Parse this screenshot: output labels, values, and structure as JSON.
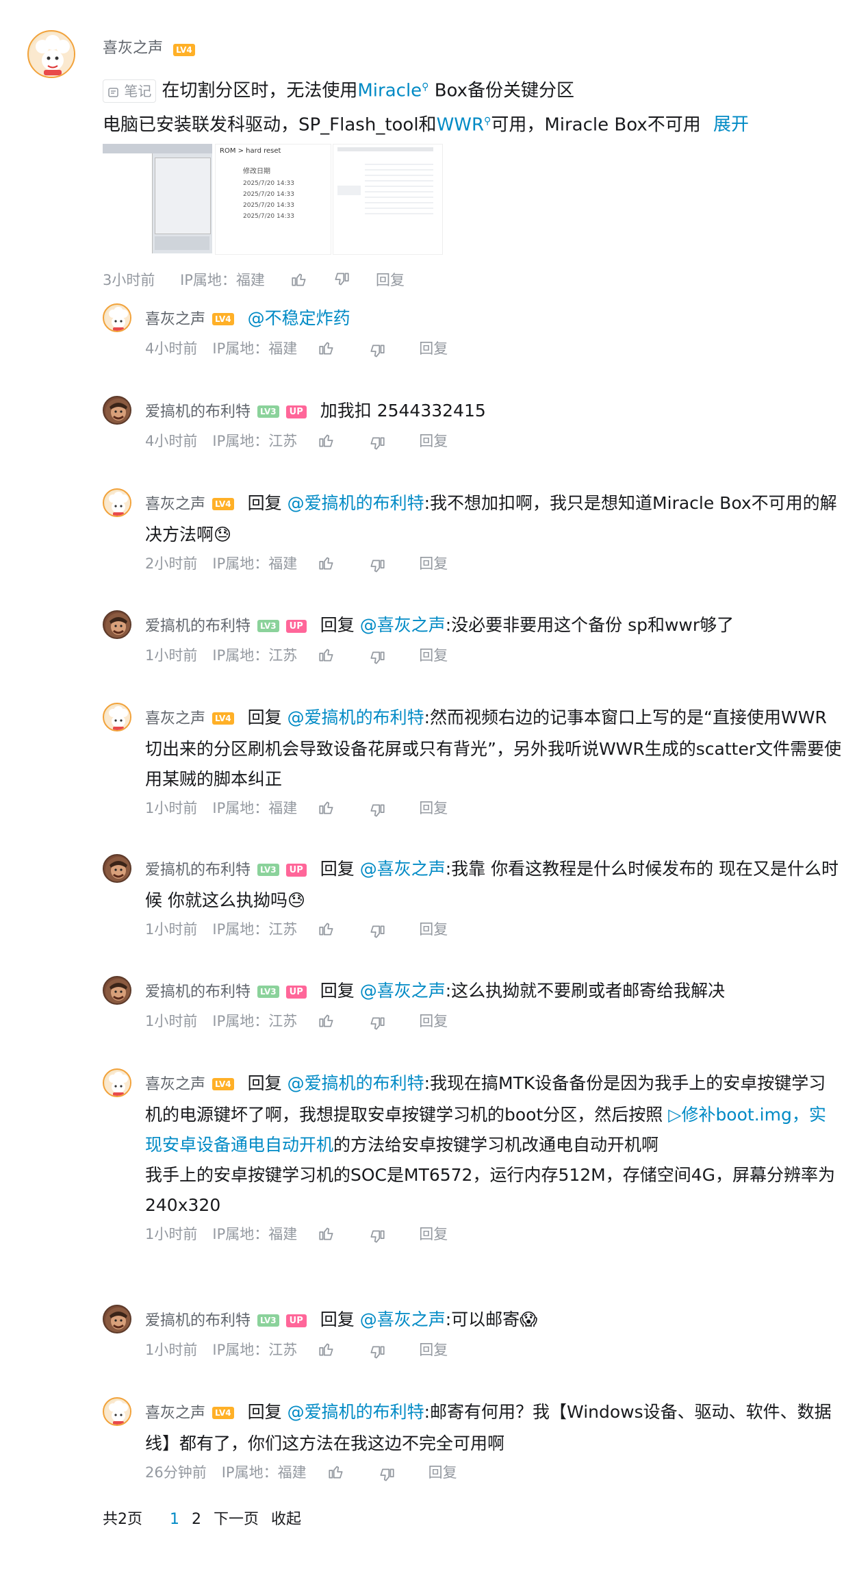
{
  "root": {
    "username": "喜灰之声",
    "level": "LV4",
    "note_label": "笔记",
    "line1_a": "在切割分区时，无法使用",
    "line1_link": "Miracle",
    "line1_b": " Box备份关键分区",
    "line2_a": "电脑已安装联发科驱动，SP_Flash_tool和",
    "line2_link": "WWR",
    "line2_b": "可用，Miracle Box不可用",
    "expand": "展开",
    "image2_path": "ROM  >  hard reset",
    "image2_col": "修改日期",
    "image2_dates": [
      "2025/7/20 14:33",
      "2025/7/20 14:33",
      "2025/7/20 14:33",
      "2025/7/20 14:33"
    ],
    "time": "3小时前",
    "ip": "IP属地：福建",
    "reply_label": "回复"
  },
  "replies": [
    {
      "user": "喜灰之声",
      "level": "LV4",
      "up": false,
      "prefix": "",
      "mention": "@不稳定炸药",
      "text": "",
      "time": "4小时前",
      "ip": "IP属地：福建"
    },
    {
      "user": "爱搞机的布利特",
      "level": "LV3",
      "up": true,
      "prefix": "",
      "mention": "",
      "text": "加我扣 2544332415",
      "time": "4小时前",
      "ip": "IP属地：江苏"
    },
    {
      "user": "喜灰之声",
      "level": "LV4",
      "up": false,
      "prefix": "回复",
      "mention": "@爱搞机的布利特",
      "text": ":我不想加扣啊，我只是想知道Miracle Box不可用的解决方法啊😓",
      "time": "2小时前",
      "ip": "IP属地：福建"
    },
    {
      "user": "爱搞机的布利特",
      "level": "LV3",
      "up": true,
      "prefix": "回复",
      "mention": "@喜灰之声",
      "text": ":没必要非要用这个备份 sp和wwr够了",
      "time": "1小时前",
      "ip": "IP属地：江苏"
    },
    {
      "user": "喜灰之声",
      "level": "LV4",
      "up": false,
      "prefix": "回复",
      "mention": "@爱搞机的布利特",
      "text": ":然而视频右边的记事本窗口上写的是“直接使用WWR切出来的分区刷机会导致设备花屏或只有背光”，另外我听说WWR生成的scatter文件需要使用某贼的脚本纠正",
      "time": "1小时前",
      "ip": "IP属地：福建"
    },
    {
      "user": "爱搞机的布利特",
      "level": "LV3",
      "up": true,
      "prefix": "回复",
      "mention": "@喜灰之声",
      "text": ":我靠 你看这教程是什么时候发布的 现在又是什么时候 你就这么执拗吗😓",
      "time": "1小时前",
      "ip": "IP属地：江苏"
    },
    {
      "user": "爱搞机的布利特",
      "level": "LV3",
      "up": true,
      "prefix": "回复",
      "mention": "@喜灰之声",
      "text": ":这么执拗就不要刷或者邮寄给我解决",
      "time": "1小时前",
      "ip": "IP属地：江苏"
    },
    {
      "user": "喜灰之声",
      "level": "LV4",
      "up": false,
      "prefix": "回复",
      "mention": "@爱搞机的布利特",
      "text": ":我现在搞MTK设备备份是因为我手上的安卓按键学习机的电源键坏了啊，我想提取安卓按键学习机的boot分区，然后按照",
      "link": "修补boot.img，实现安卓设备通电自动开机",
      "text2": "的方法给安卓按键学习机改通电自动开机啊",
      "text3": "我手上的安卓按键学习机的SOC是MT6572，运行内存512M，存储空间4G，屏幕分辨率为240x320",
      "time": "1小时前",
      "ip": "IP属地：福建"
    },
    {
      "user": "爱搞机的布利特",
      "level": "LV3",
      "up": true,
      "prefix": "回复",
      "mention": "@喜灰之声",
      "text": ":可以邮寄😱",
      "time": "1小时前",
      "ip": "IP属地：江苏"
    },
    {
      "user": "喜灰之声",
      "level": "LV4",
      "up": false,
      "prefix": "回复",
      "mention": "@爱搞机的布利特",
      "text": ":邮寄有何用？我【Windows设备、驱动、软件、数据线】都有了，你们这方法在我这边不完全可用啊",
      "time": "26分钟前",
      "ip": "IP属地：福建"
    }
  ],
  "up_label": "UP",
  "reply_label": "回复",
  "pager": {
    "total": "共2页",
    "p1": "1",
    "p2": "2",
    "next": "下一页",
    "collapse": "收起"
  }
}
